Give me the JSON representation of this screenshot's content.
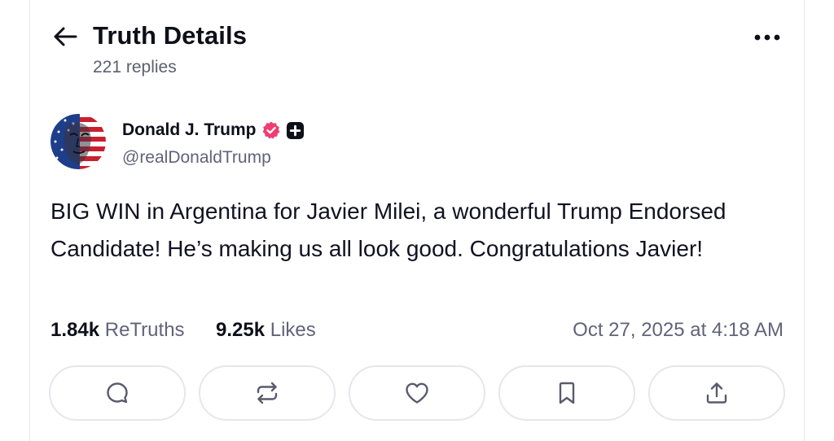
{
  "header": {
    "title": "Truth Details",
    "replies": "221 replies"
  },
  "post": {
    "author": {
      "display_name": "Donald J. Trump",
      "handle": "@realDonaldTrump"
    },
    "text": "BIG WIN in Argentina for Javier Milei, a wonderful Trump Endorsed Candidate! He’s making us all look good. Congratulations Javier!",
    "stats": {
      "retruths_count": "1.84k",
      "retruths_label": "ReTruths",
      "likes_count": "9.25k",
      "likes_label": "Likes"
    },
    "timestamp": "Oct 27, 2025 at 4:18 AM"
  },
  "actions": [
    {
      "icon": "reply-icon"
    },
    {
      "icon": "retruth-icon"
    },
    {
      "icon": "like-icon"
    },
    {
      "icon": "bookmark-icon"
    },
    {
      "icon": "share-icon"
    }
  ],
  "colors": {
    "verified_badge": "#ef3d73",
    "text_primary": "#0f0f1a",
    "text_secondary": "#62627a",
    "border": "#e6e6ec"
  }
}
